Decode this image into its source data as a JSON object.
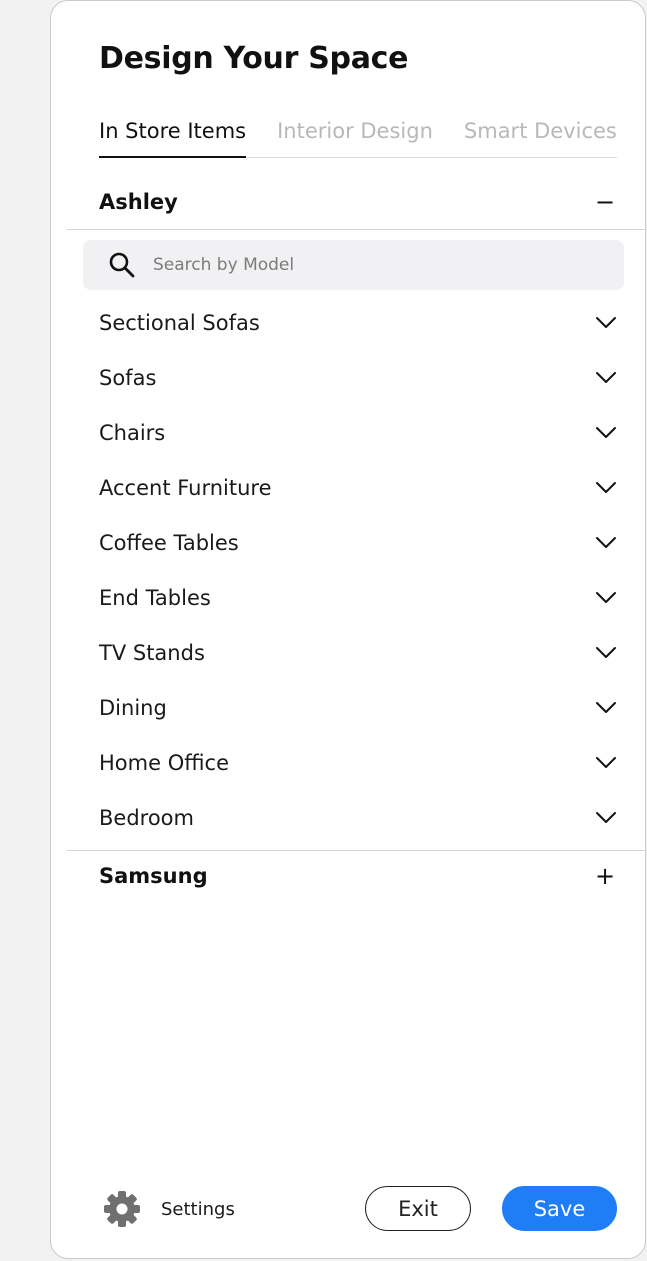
{
  "panel": {
    "title": "Design Your Space"
  },
  "tabs": [
    {
      "label": "In Store Items",
      "active": true
    },
    {
      "label": "Interior Design",
      "active": false
    },
    {
      "label": "Smart Devices",
      "active": false
    }
  ],
  "groups": {
    "ashley": {
      "name": "Ashley",
      "toggle": "−",
      "expanded": true
    },
    "samsung": {
      "name": "Samsung",
      "toggle": "+",
      "expanded": false
    }
  },
  "search": {
    "placeholder": "Search by Model",
    "icon": "search-icon"
  },
  "categories": [
    {
      "label": "Sectional Sofas",
      "icon": "chevron-down-icon"
    },
    {
      "label": "Sofas",
      "icon": "chevron-down-icon"
    },
    {
      "label": "Chairs",
      "icon": "chevron-down-icon"
    },
    {
      "label": "Accent Furniture",
      "icon": "chevron-down-icon"
    },
    {
      "label": "Coffee Tables",
      "icon": "chevron-down-icon"
    },
    {
      "label": "End Tables",
      "icon": "chevron-down-icon"
    },
    {
      "label": "TV Stands",
      "icon": "chevron-down-icon"
    },
    {
      "label": "Dining",
      "icon": "chevron-down-icon"
    },
    {
      "label": "Home Office",
      "icon": "chevron-down-icon"
    },
    {
      "label": "Bedroom",
      "icon": "chevron-down-icon"
    }
  ],
  "footer": {
    "settings_label": "Settings",
    "settings_icon": "gear-icon",
    "exit_label": "Exit",
    "save_label": "Save"
  },
  "colors": {
    "accent": "#1f7ef7",
    "inactive_tab": "#b8b8b8",
    "search_bg": "#f1f1f3",
    "outer_bg": "#f2f2f2"
  }
}
